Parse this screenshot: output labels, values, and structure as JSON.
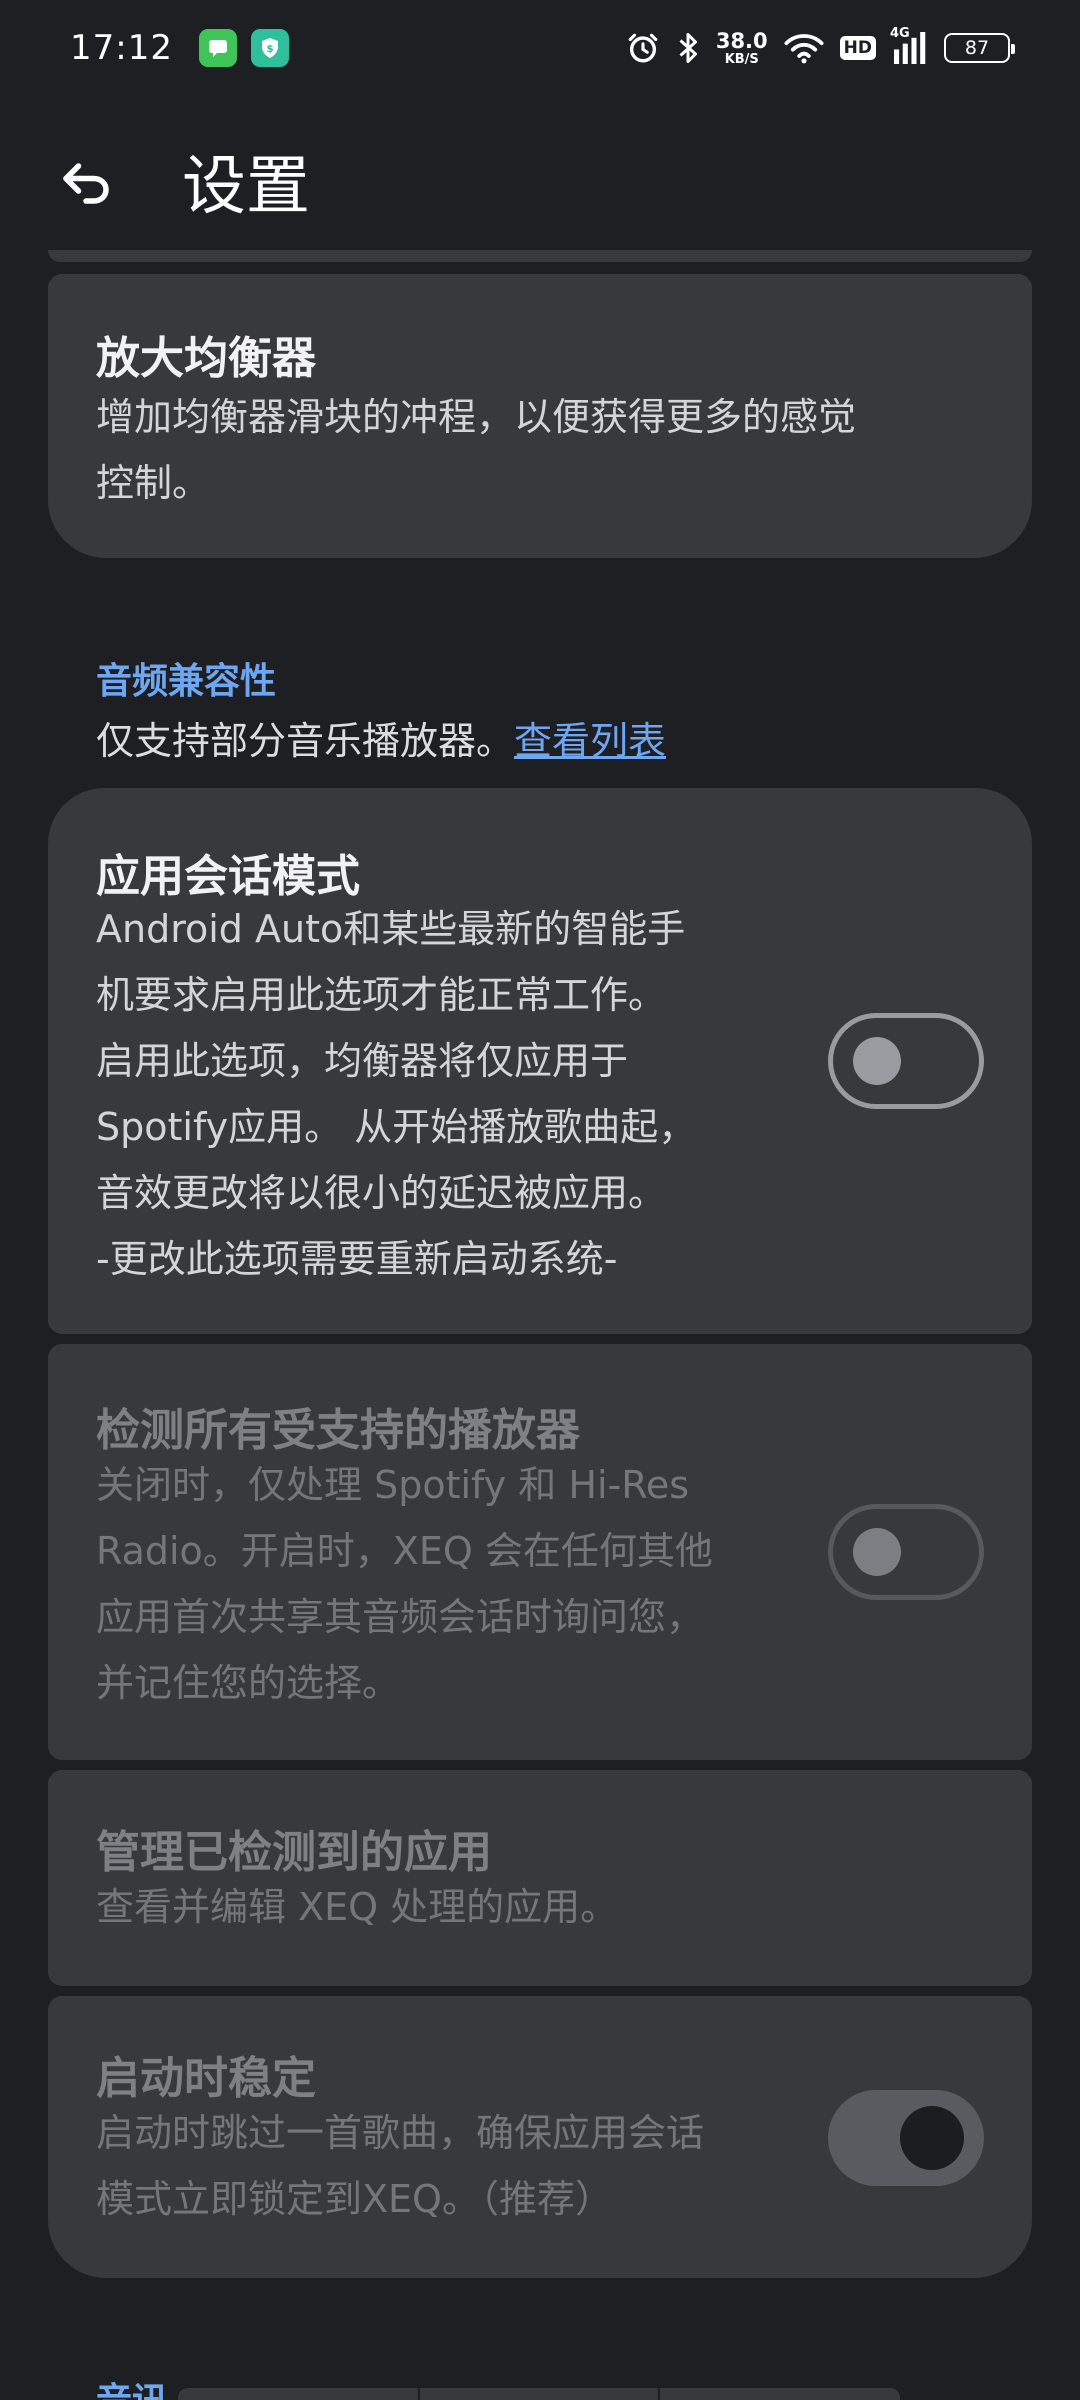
{
  "status_bar": {
    "time": "17:12",
    "net_speed_value": "38.0",
    "net_speed_unit": "KB/S",
    "hd": "HD",
    "network_type": "4G",
    "battery": "87"
  },
  "app_bar": {
    "title": "设置",
    "back_icon": "back-arrow-icon"
  },
  "magnify_eq": {
    "title": "放大均衡器",
    "desc_line1": "增加均衡器滑块的冲程，以便获得更多的感觉",
    "desc_line2": "控制。"
  },
  "audio_compat": {
    "header": "音频兼容性",
    "note": "仅支持部分音乐播放器。",
    "link": "查看列表"
  },
  "session_mode": {
    "title": "应用会话模式",
    "lines": [
      "Android Auto和某些最新的智能手",
      "机要求启用此选项才能正常工作。",
      "启用此选项，均衡器将仅应用于",
      "Spotify应用。 从开始播放歌曲起，",
      "音效更改将以很小的延迟被应用。",
      "-更改此选项需要重新启动系统-"
    ],
    "enabled": false
  },
  "detect_players": {
    "title": "检测所有受支持的播放器",
    "lines": [
      "关闭时，仅处理 Spotify 和 Hi-Res",
      "Radio。开启时，XEQ 会在任何其他",
      "应用首次共享其音频会话时询问您，",
      "并记住您的选择。"
    ],
    "enabled": false
  },
  "manage_apps": {
    "title": "管理已检测到的应用",
    "desc": "查看并编辑 XEQ 处理的应用。"
  },
  "stable_start": {
    "title": "启动时稳定",
    "lines": [
      "启动时跳过一首歌曲，确保应用会话",
      "模式立即锁定到XEQ。（推荐）"
    ],
    "enabled": true
  },
  "next_section": {
    "header": "音讯"
  },
  "colors": {
    "background": "#1e1f22",
    "card": "#38393d",
    "accent": "#6ea6f2"
  }
}
